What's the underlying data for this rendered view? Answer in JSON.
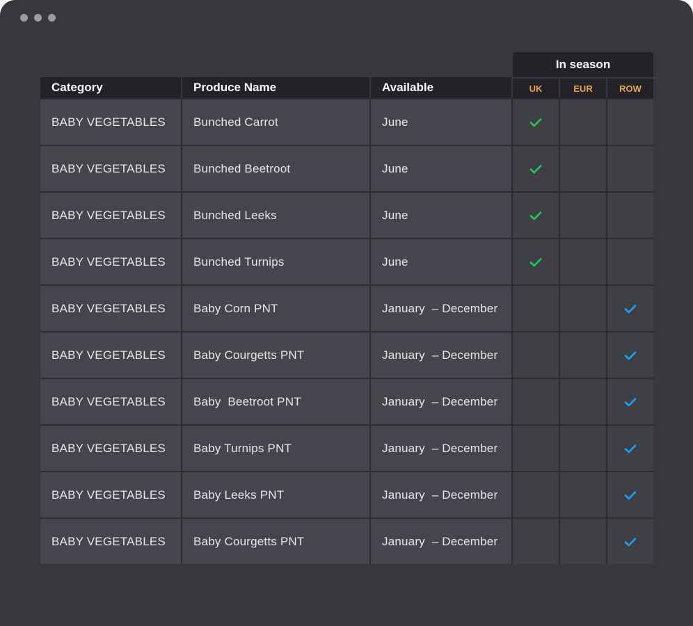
{
  "table": {
    "headers": {
      "category": "Category",
      "produce_name": "Produce Name",
      "available": "Available",
      "in_season": "In season",
      "regions": [
        "UK",
        "EUR",
        "ROW"
      ]
    },
    "rows": [
      {
        "category": "BABY VEGETABLES",
        "name": "Bunched Carrot",
        "available": "June",
        "uk": true,
        "eur": false,
        "row": false
      },
      {
        "category": "BABY VEGETABLES",
        "name": "Bunched Beetroot",
        "available": "June",
        "uk": true,
        "eur": false,
        "row": false
      },
      {
        "category": "BABY VEGETABLES",
        "name": "Bunched Leeks",
        "available": "June",
        "uk": true,
        "eur": false,
        "row": false
      },
      {
        "category": "BABY VEGETABLES",
        "name": "Bunched Turnips",
        "available": "June",
        "uk": true,
        "eur": false,
        "row": false
      },
      {
        "category": "BABY VEGETABLES",
        "name": "Baby Corn PNT",
        "available": "January  – December",
        "uk": false,
        "eur": false,
        "row": true
      },
      {
        "category": "BABY VEGETABLES",
        "name": "Baby Courgetts PNT",
        "available": "January  – December",
        "uk": false,
        "eur": false,
        "row": true
      },
      {
        "category": "BABY VEGETABLES",
        "name": "Baby  Beetroot PNT",
        "available": "January  – December",
        "uk": false,
        "eur": false,
        "row": true
      },
      {
        "category": "BABY VEGETABLES",
        "name": "Baby Turnips PNT",
        "available": "January  – December",
        "uk": false,
        "eur": false,
        "row": true
      },
      {
        "category": "BABY VEGETABLES",
        "name": "Baby Leeks PNT",
        "available": "January  – December",
        "uk": false,
        "eur": false,
        "row": true
      },
      {
        "category": "BABY VEGETABLES",
        "name": "Baby Courgetts PNT",
        "available": "January  – December",
        "uk": false,
        "eur": false,
        "row": true
      }
    ]
  },
  "colors": {
    "uk_check": "#22c55e",
    "row_check": "#1da1f2",
    "region_header": "#e4a54e"
  },
  "icons": {
    "window_control": "dot-icon",
    "in_season_mark": "checkmark-icon"
  }
}
